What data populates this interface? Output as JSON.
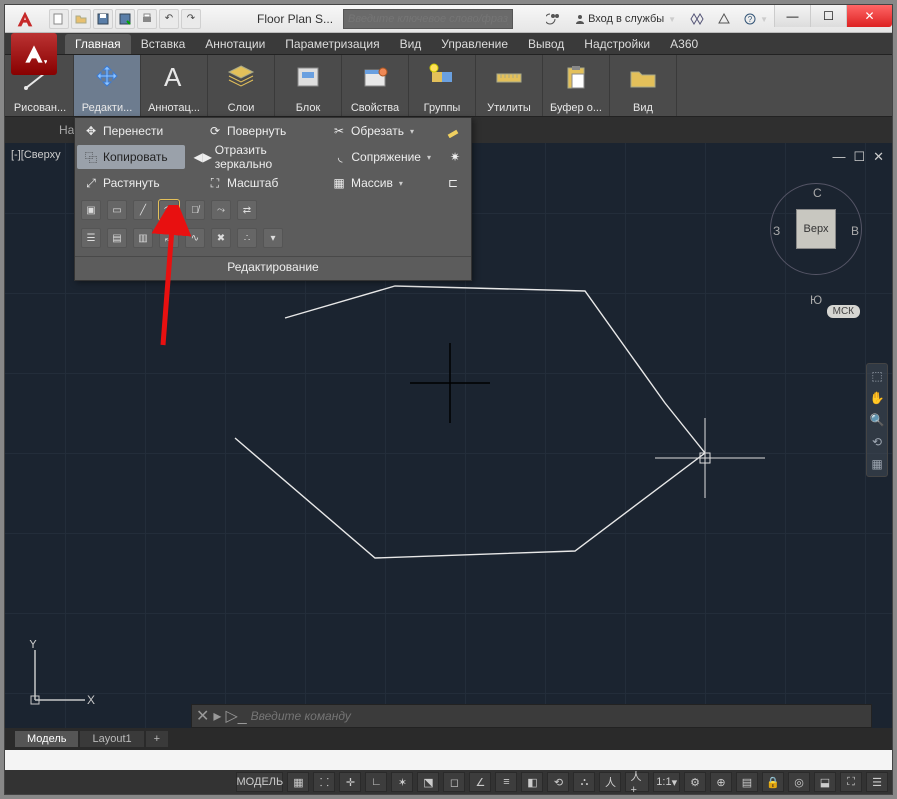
{
  "title": {
    "document": "Floor Plan S...",
    "search_placeholder": "Введите ключевое слово/фразу",
    "signin": "Вход в службы"
  },
  "menutabs": [
    "Главная",
    "Вставка",
    "Аннотации",
    "Параметризация",
    "Вид",
    "Управление",
    "Вывод",
    "Надстройки",
    "A360"
  ],
  "ribbon": {
    "draw": "Рисован...",
    "edit": "Редакти...",
    "annot": "Аннотац...",
    "layers": "Слои",
    "block": "Блок",
    "props": "Свойства",
    "groups": "Группы",
    "utils": "Утилиты",
    "clipboard": "Буфер о...",
    "view": "Вид"
  },
  "starttab": "Нача...",
  "editpanel": {
    "title": "Редактирование",
    "move": "Перенести",
    "rotate": "Повернуть",
    "trim": "Обрезать",
    "copy": "Копировать",
    "mirror": "Отразить зеркально",
    "fillet": "Сопряжение",
    "stretch": "Растянуть",
    "scale": "Масштаб",
    "array": "Массив"
  },
  "canvas": {
    "view_label": "[-][Сверху",
    "viewcube": {
      "top": "Верх",
      "n": "С",
      "s": "Ю",
      "w": "З",
      "e": "В"
    },
    "wcs": "МСК",
    "ucs": {
      "x": "X",
      "y": "Y"
    },
    "cmd_placeholder": "Введите команду"
  },
  "layouttabs": {
    "model": "Модель",
    "layout1": "Layout1",
    "plus": "+"
  },
  "status": {
    "model": "МОДЕЛЬ",
    "scale": "1:1"
  }
}
